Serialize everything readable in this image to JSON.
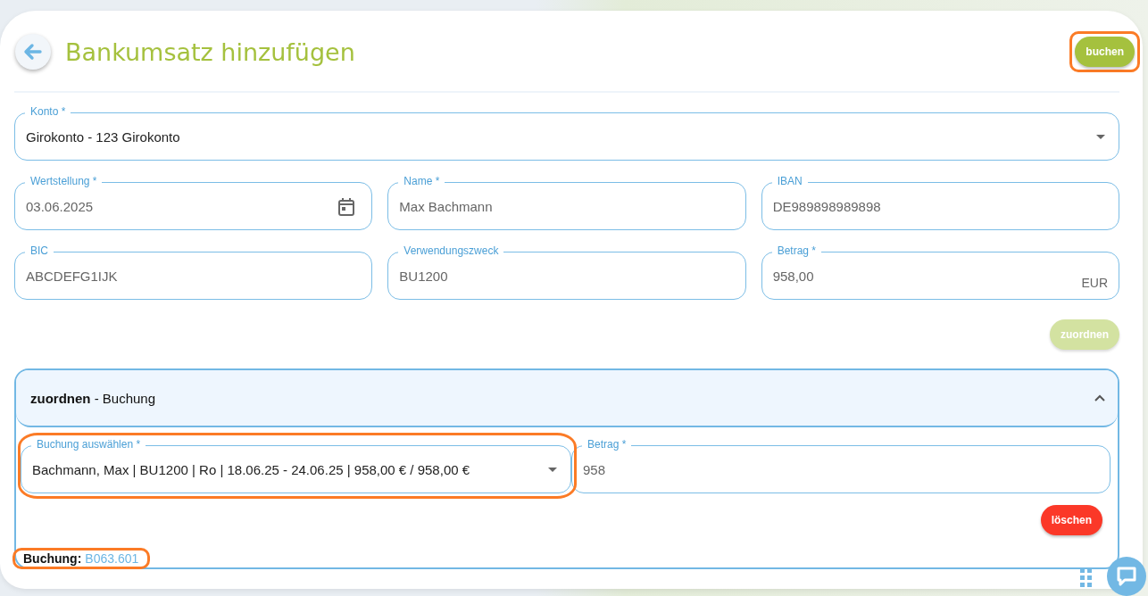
{
  "header": {
    "title": "Bankumsatz hinzufügen",
    "action": {
      "label": "buchen",
      "highlighted": true
    }
  },
  "account": {
    "label": "Konto *",
    "value": "Girokonto - 123 Girokonto"
  },
  "fields": [
    {
      "kind": "date",
      "label": "Wertstellung *",
      "value": "03.06.2025"
    },
    {
      "kind": "text",
      "label": "Name *",
      "value": "Max Bachmann"
    },
    {
      "kind": "text",
      "label": "IBAN",
      "value": "DE989898989898"
    },
    {
      "kind": "text",
      "label": "BIC",
      "value": "ABCDEFG1IJK"
    },
    {
      "kind": "text",
      "label": "Verwendungszweck",
      "value": "BU1200"
    },
    {
      "kind": "currency",
      "label": "Betrag *",
      "value": "958,00",
      "suffix": "EUR"
    }
  ],
  "assign_button": {
    "label": "zuordnen",
    "disabled": true
  },
  "panel": {
    "title": "**zuordnen** - Buchung",
    "expanded": true,
    "select": {
      "label": "Buchung auswählen *",
      "value": "Bachmann, Max | BU1200 | Ro | 18.06.25 - 24.06.25 |  958,00 € / 958,00 €",
      "highlighted": true
    },
    "amount": {
      "label": "Betrag *",
      "value": "958"
    },
    "delete_button": {
      "label": "löschen"
    },
    "reference": {
      "label": "Buchung",
      "separator": ":",
      "link": "B063.601",
      "highlighted": true
    }
  }
}
